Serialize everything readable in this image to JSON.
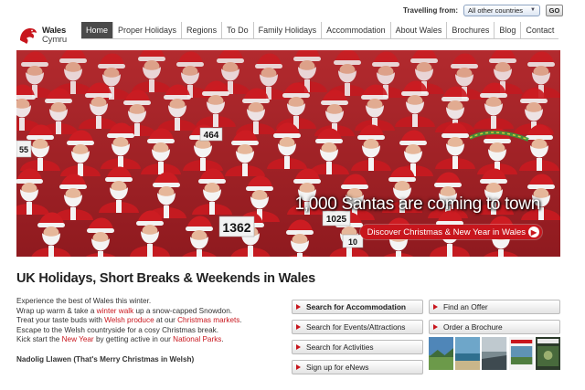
{
  "topbar": {
    "travelling_from_label": "Travelling from:",
    "country_selected": "All other countries",
    "go_label": "GO"
  },
  "logo": {
    "line1": "Wales",
    "line2": "Cymru"
  },
  "nav": {
    "items": [
      {
        "label": "Home",
        "active": true
      },
      {
        "label": "Proper Holidays"
      },
      {
        "label": "Regions"
      },
      {
        "label": "To Do"
      },
      {
        "label": "Family Holidays"
      },
      {
        "label": "Accommodation"
      },
      {
        "label": "About Wales"
      },
      {
        "label": "Brochures"
      },
      {
        "label": "Blog"
      },
      {
        "label": "Contact"
      }
    ]
  },
  "hero": {
    "headline": "1,000 Santas are coming to town",
    "cta": "Discover Christmas & New Year in Wales",
    "bibs": [
      "464",
      "1362",
      "1025",
      "55",
      "10"
    ]
  },
  "main": {
    "title": "UK Holidays, Short Breaks & Weekends in Wales",
    "intro": {
      "l1": "Experience the best of Wales this winter.",
      "l2a": "Wrap up warm & take a ",
      "l2link": "winter walk",
      "l2b": " up a snow-capped Snowdon.",
      "l3a": "Treat your taste buds with ",
      "l3link1": "Welsh produce",
      "l3b": " at our ",
      "l3link2": "Christmas markets",
      "l3c": ".",
      "l4": "Escape to the Welsh countryside for a cosy Christmas break.",
      "l5a": "Kick start the ",
      "l5link1": "New Year",
      "l5b": " by getting active in our ",
      "l5link2": "National Parks",
      "l5c": "."
    },
    "nadolig": "Nadolig Llawen (That's Merry Christmas in Welsh)"
  },
  "actions": {
    "search_accommodation": "Search for Accommodation",
    "search_events": "Search for Events/Attractions",
    "search_activities": "Search for Activities",
    "sign_up": "Sign up for eNews",
    "find_offer": "Find an Offer",
    "order_brochure": "Order a Brochure"
  },
  "colors": {
    "brand_red": "#c8161d",
    "nav_active": "#4a4a4a",
    "link": "#c8161d"
  }
}
